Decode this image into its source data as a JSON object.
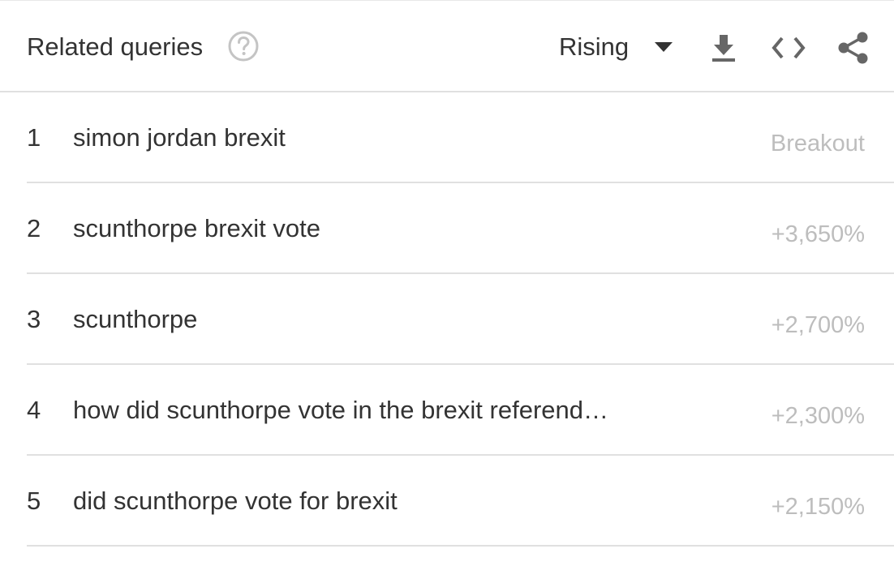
{
  "header": {
    "title": "Related queries",
    "help_icon": "help-circle-icon",
    "filter_value": "Rising",
    "tools": [
      {
        "icon": "download-icon"
      },
      {
        "icon": "embed-code-icon"
      },
      {
        "icon": "share-icon"
      }
    ]
  },
  "queries": [
    {
      "rank": "1",
      "text": "simon jordan brexit",
      "value": "Breakout"
    },
    {
      "rank": "2",
      "text": "scunthorpe brexit vote",
      "value": "+3,650%"
    },
    {
      "rank": "3",
      "text": "scunthorpe",
      "value": "+2,700%"
    },
    {
      "rank": "4",
      "text": "how did scunthorpe vote in the brexit referend…",
      "value": "+2,300%"
    },
    {
      "rank": "5",
      "text": "did scunthorpe vote for brexit",
      "value": "+2,150%"
    }
  ],
  "colors": {
    "text": "#333333",
    "muted": "#bdbdbd",
    "icon": "#666666",
    "divider": "#e0e0e0"
  }
}
